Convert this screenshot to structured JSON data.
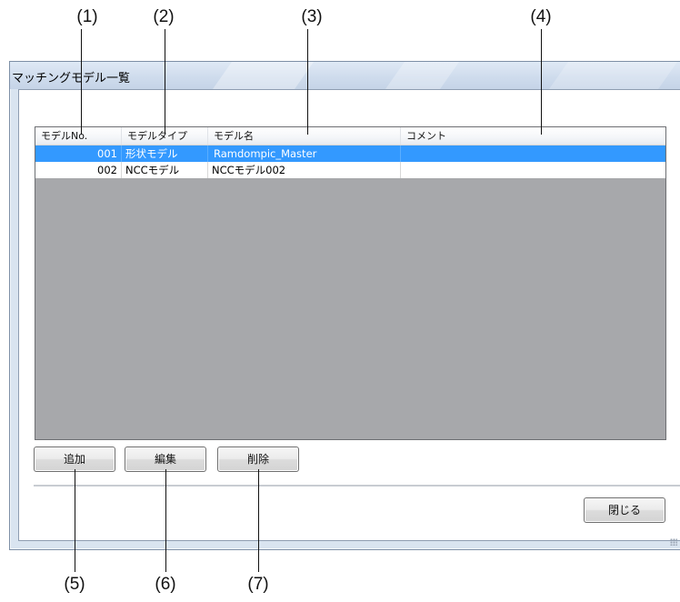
{
  "callouts": {
    "top": [
      "(1)",
      "(2)",
      "(3)",
      "(4)"
    ],
    "bottom": [
      "(5)",
      "(6)",
      "(7)"
    ]
  },
  "window": {
    "title": "マッチングモデル一覧"
  },
  "listview": {
    "columns": [
      "モデルNo.",
      "モデルタイプ",
      "モデル名",
      "コメント"
    ],
    "rows": [
      {
        "no": "001",
        "type": "形状モデル",
        "name": "Ramdompic_Master",
        "comment": "",
        "selected": true
      },
      {
        "no": "002",
        "type": "NCCモデル",
        "name": "NCCモデル002",
        "comment": "",
        "selected": false
      }
    ]
  },
  "buttons": {
    "add": "追加",
    "edit": "編集",
    "delete": "削除",
    "close": "閉じる"
  },
  "colors": {
    "selection": "#3399ff",
    "list_background": "#a7a8ab"
  }
}
